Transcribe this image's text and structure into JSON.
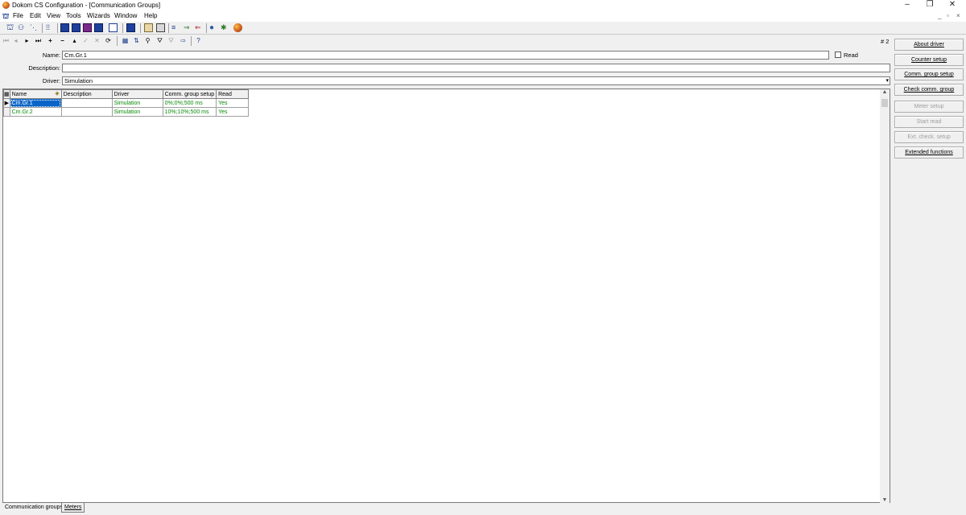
{
  "window": {
    "title": "Dokom CS Configuration - [Communication Groups]"
  },
  "menu": {
    "items": [
      "File",
      "Edit",
      "View",
      "Tools",
      "Wizards",
      "Window",
      "Help"
    ]
  },
  "record_indicator": "# 2",
  "form": {
    "name_label": "Name:",
    "name_value": "Cm.Gr.1",
    "read_label": "Read",
    "description_label": "Description:",
    "description_value": "",
    "driver_label": "Driver:",
    "driver_value": "Simulation"
  },
  "grid": {
    "columns": [
      "Name",
      "Description",
      "Driver",
      "Comm. group setup",
      "Read"
    ],
    "rows": [
      [
        "Cm.Gr.1",
        "",
        "Simulation",
        "0%;0%;500 ms",
        "Yes"
      ],
      [
        "Cm.Gr.2",
        "",
        "Simulation",
        "10%;10%;500 ms",
        "Yes"
      ]
    ]
  },
  "side_buttons": [
    {
      "label": "About driver",
      "enabled": true
    },
    {
      "label": "Counter setup",
      "enabled": true
    },
    {
      "label": "Comm. group setup",
      "enabled": true
    },
    {
      "label": "Check comm. group",
      "enabled": true
    },
    {
      "label": "Meter setup",
      "enabled": false
    },
    {
      "label": "Start read",
      "enabled": false
    },
    {
      "label": "Ext. check. setup",
      "enabled": false
    },
    {
      "label": "Extended functions",
      "enabled": true
    }
  ],
  "tabs": [
    "Communication groups",
    "Meters"
  ],
  "colors": {
    "selection": "#0a64c8",
    "grid_text": "#0a8a0a",
    "disabled_text": "#a0a0a0"
  }
}
